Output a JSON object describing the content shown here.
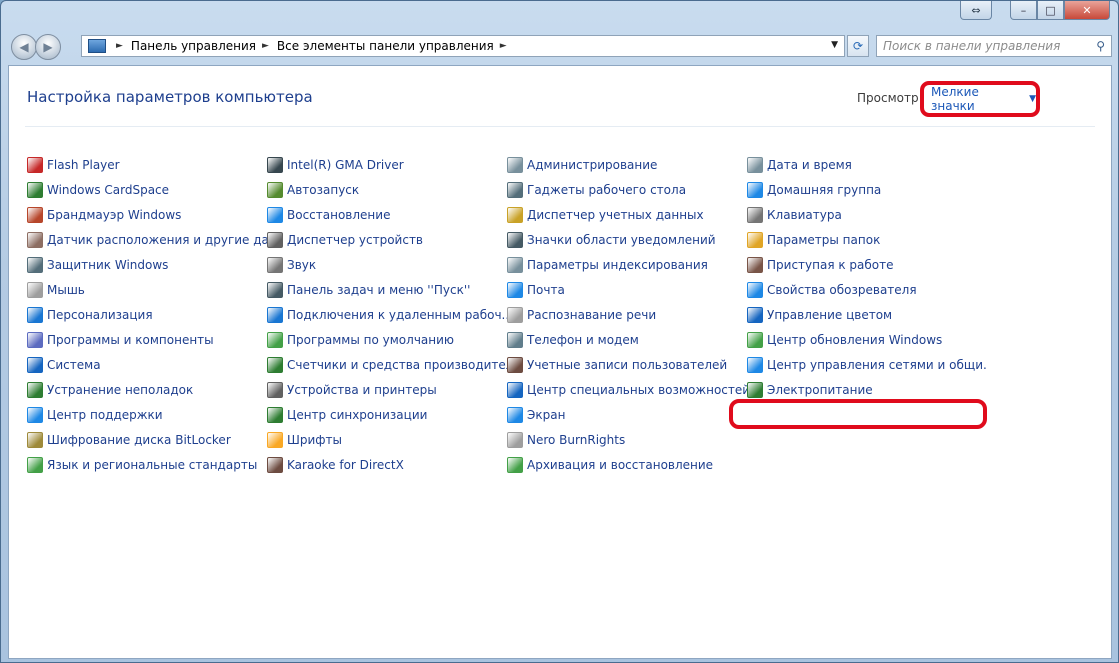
{
  "window": {
    "min": "–",
    "max": "□",
    "close": "✕",
    "extra": "⇔"
  },
  "nav": {
    "back": "◀",
    "forward": "▶",
    "breadcrumbs": [
      "Панель управления",
      "Все элементы панели управления"
    ],
    "search_placeholder": "Поиск в панели управления"
  },
  "header": {
    "title": "Настройка параметров компьютера",
    "view_label": "Просмотр:",
    "view_value": "Мелкие значки"
  },
  "items": [
    {
      "label": "Flash Player",
      "icon": "flash-icon",
      "color": "#c62828"
    },
    {
      "label": "Windows CardSpace",
      "icon": "cardspace-icon",
      "color": "#2e7d32"
    },
    {
      "label": "Брандмауэр Windows",
      "icon": "firewall-icon",
      "color": "#b7462b"
    },
    {
      "label": "Датчик расположения и другие дат...",
      "icon": "sensor-icon",
      "color": "#8d6e63"
    },
    {
      "label": "Защитник Windows",
      "icon": "defender-icon",
      "color": "#546e7a"
    },
    {
      "label": "Мышь",
      "icon": "mouse-icon",
      "color": "#9e9e9e"
    },
    {
      "label": "Персонализация",
      "icon": "personalization-icon",
      "color": "#1976d2"
    },
    {
      "label": "Программы и компоненты",
      "icon": "programs-icon",
      "color": "#5c6bc0"
    },
    {
      "label": "Система",
      "icon": "system-icon",
      "color": "#1565c0"
    },
    {
      "label": "Устранение неполадок",
      "icon": "troubleshoot-icon",
      "color": "#2e7d32"
    },
    {
      "label": "Центр поддержки",
      "icon": "flag-icon",
      "color": "#1e88e5"
    },
    {
      "label": "Шифрование диска BitLocker",
      "icon": "bitlocker-icon",
      "color": "#9e8a3a"
    },
    {
      "label": "Язык и региональные стандарты",
      "icon": "globe-icon",
      "color": "#43a047"
    },
    {
      "label": "Intel(R) GMA Driver",
      "icon": "intel-icon",
      "color": "#37474f"
    },
    {
      "label": "Автозапуск",
      "icon": "autoplay-icon",
      "color": "#558b2f"
    },
    {
      "label": "Восстановление",
      "icon": "restore-icon",
      "color": "#1e88e5"
    },
    {
      "label": "Диспетчер устройств",
      "icon": "device-manager-icon",
      "color": "#616161"
    },
    {
      "label": "Звук",
      "icon": "sound-icon",
      "color": "#757575"
    },
    {
      "label": "Панель задач и меню ''Пуск''",
      "icon": "taskbar-icon",
      "color": "#455a64"
    },
    {
      "label": "Подключения к удаленным рабоч...",
      "icon": "remote-icon",
      "color": "#1976d2"
    },
    {
      "label": "Программы по умолчанию",
      "icon": "default-programs-icon",
      "color": "#43a047"
    },
    {
      "label": "Счетчики и средства производител...",
      "icon": "performance-icon",
      "color": "#2e7d32"
    },
    {
      "label": "Устройства и принтеры",
      "icon": "printer-icon",
      "color": "#616161"
    },
    {
      "label": "Центр синхронизации",
      "icon": "sync-icon",
      "color": "#2e7d32"
    },
    {
      "label": "Шрифты",
      "icon": "fonts-icon",
      "color": "#f9a825"
    },
    {
      "label": "Karaoke for DirectX",
      "icon": "karaoke-icon",
      "color": "#6d4c41"
    },
    {
      "label": "Администрирование",
      "icon": "admin-tools-icon",
      "color": "#78909c"
    },
    {
      "label": "Гаджеты рабочего стола",
      "icon": "gadgets-icon",
      "color": "#546e7a"
    },
    {
      "label": "Диспетчер учетных данных",
      "icon": "credentials-icon",
      "color": "#c9a227"
    },
    {
      "label": "Значки области уведомлений",
      "icon": "notification-icon",
      "color": "#455a64"
    },
    {
      "label": "Параметры индексирования",
      "icon": "indexing-icon",
      "color": "#78909c"
    },
    {
      "label": "Почта",
      "icon": "mail-icon",
      "color": "#1e88e5"
    },
    {
      "label": "Распознавание речи",
      "icon": "microphone-icon",
      "color": "#9e9e9e"
    },
    {
      "label": "Телефон и модем",
      "icon": "phone-icon",
      "color": "#607d8b"
    },
    {
      "label": "Учетные записи пользователей",
      "icon": "users-icon",
      "color": "#6d4c41"
    },
    {
      "label": "Центр специальных возможностей",
      "icon": "accessibility-icon",
      "color": "#1565c0"
    },
    {
      "label": "Экран",
      "icon": "display-icon",
      "color": "#1e88e5"
    },
    {
      "label": "Nero BurnRights",
      "icon": "nero-icon",
      "color": "#9e9e9e"
    },
    {
      "label": "Архивация и восстановление",
      "icon": "backup-icon",
      "color": "#43a047"
    },
    {
      "label": "Дата и время",
      "icon": "clock-icon",
      "color": "#78909c"
    },
    {
      "label": "Домашняя группа",
      "icon": "homegroup-icon",
      "color": "#1e88e5"
    },
    {
      "label": "Клавиатура",
      "icon": "keyboard-icon",
      "color": "#757575"
    },
    {
      "label": "Параметры папок",
      "icon": "folder-icon",
      "color": "#e0a526"
    },
    {
      "label": "Приступая к работе",
      "icon": "getting-started-icon",
      "color": "#795548"
    },
    {
      "label": "Свойства обозревателя",
      "icon": "internet-options-icon",
      "color": "#1e88e5"
    },
    {
      "label": "Управление цветом",
      "icon": "color-management-icon",
      "color": "#1565c0"
    },
    {
      "label": "Центр обновления Windows",
      "icon": "windows-update-icon",
      "color": "#43a047"
    },
    {
      "label": "Центр управления сетями и общи...",
      "icon": "network-icon",
      "color": "#1e88e5"
    },
    {
      "label": "Электропитание",
      "icon": "power-icon",
      "color": "#2e7d32"
    }
  ]
}
